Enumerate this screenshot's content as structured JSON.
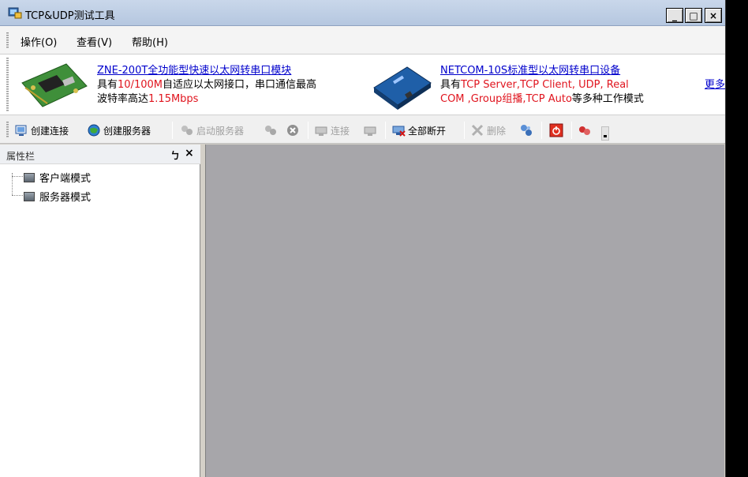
{
  "window": {
    "title": "TCP&UDP测试工具",
    "buttons": {
      "minimize": "_",
      "maximize": "□",
      "close": "×"
    }
  },
  "menu": [
    {
      "label": "操作(O)"
    },
    {
      "label": "查看(V)"
    },
    {
      "label": "帮助(H)"
    }
  ],
  "banner": {
    "ad1": {
      "title": "ZNE-200T全功能型快速以太网转串口模块",
      "line1_prefix": "具有",
      "line1_highlight": "10/100M",
      "line1_suffix": "自适应以太网接口，串口通信最高",
      "line2_prefix": "波特率高达",
      "line2_highlight": "1.15Mbps"
    },
    "ad2": {
      "title": "NETCOM-10S标准型以太网转串口设备",
      "line1_prefix": "具有",
      "line1_highlight": "TCP Server,TCP Client, UDP, Real",
      "line2_highlight": "COM ,Group组播,TCP Auto",
      "line2_suffix": "等多种工作模式"
    },
    "more": "更多"
  },
  "toolbar": {
    "create_connection": "创建连接",
    "create_server": "创建服务器",
    "start_server": "启动服务器",
    "connect": "连接",
    "disconnect_all": "全部断开",
    "delete": "删除"
  },
  "properties": {
    "title": "属性栏",
    "pin": "ㄅ",
    "close": "×",
    "tree": [
      {
        "label": "客户端模式"
      },
      {
        "label": "服务器模式"
      }
    ]
  },
  "colors": {
    "titlebar": "#c9d7ea",
    "highlight_red": "#e0141e",
    "link_blue": "#0000cc",
    "mdi_background": "#a7a6aa"
  }
}
